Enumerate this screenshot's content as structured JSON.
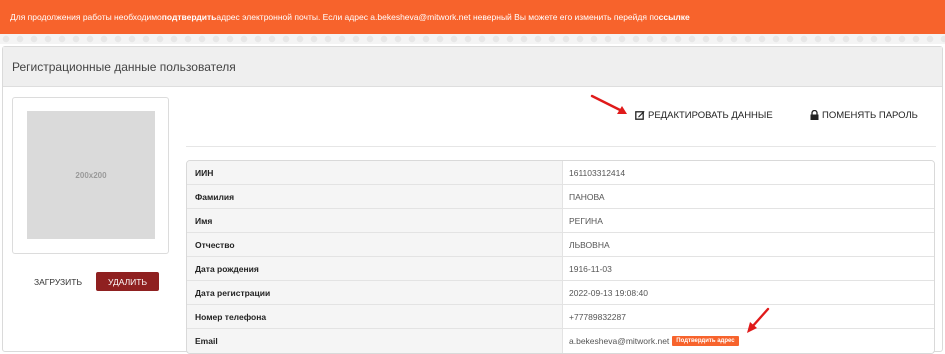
{
  "alert": {
    "part1": "Для продолжения работы необходимо ",
    "bold1": "подтвердить",
    "part2": " адрес электронной почты. Если адрес a.bekesheva@mitwork.net неверный Вы можете его изменить перейдя по ",
    "bold2": "ссылке"
  },
  "panel": {
    "title": "Регистрационные данные пользователя"
  },
  "avatar": {
    "placeholder": "200x200"
  },
  "buttons": {
    "upload": "ЗАГРУЗИТЬ",
    "delete": "УДАЛИТЬ"
  },
  "actions": {
    "edit": "РЕДАКТИРОВАТЬ ДАННЫЕ",
    "change_password": "ПОМЕНЯТЬ ПАРОЛЬ"
  },
  "table": {
    "rows": [
      {
        "label": "ИИН",
        "value": "161103312414"
      },
      {
        "label": "Фамилия",
        "value": "ПАНОВА"
      },
      {
        "label": "Имя",
        "value": "РЕГИНА"
      },
      {
        "label": "Отчество",
        "value": "ЛЬВОВНА"
      },
      {
        "label": "Дата рождения",
        "value": "1916-11-03"
      },
      {
        "label": "Дата регистрации",
        "value": "2022-09-13 19:08:40"
      },
      {
        "label": "Номер телефона",
        "value": "+77789832287"
      },
      {
        "label": "Email",
        "value": "a.bekesheva@mitwork.net"
      }
    ],
    "confirm_badge": "Подтвердить адрес"
  },
  "colors": {
    "accent": "#f7632c",
    "danger": "#8f2020",
    "arrow": "#e01b1b"
  },
  "icons": {
    "edit": "edit-square-icon",
    "lock": "lock-icon",
    "arrow": "red-arrow-annotation"
  }
}
